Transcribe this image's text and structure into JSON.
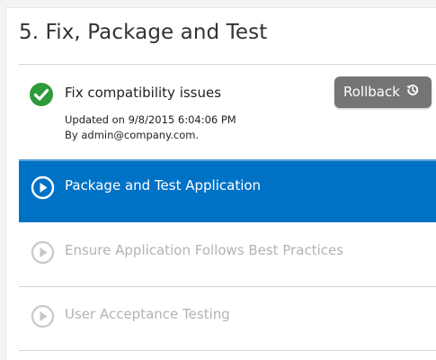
{
  "section": {
    "title": "5. Fix, Package and Test"
  },
  "completed_step": {
    "title": "Fix compatibility issues",
    "updated": "Updated on 9/8/2015 6:04:06 PM",
    "by": "By admin@company.com.",
    "rollback_label": "Rollback",
    "icon": "checkmark-circle-icon",
    "rollback_icon": "history-icon"
  },
  "steps": [
    {
      "label": "Package and Test Application",
      "state": "active",
      "icon": "play-circle-icon"
    },
    {
      "label": "Ensure Application Follows Best Practices",
      "state": "pending",
      "icon": "play-circle-icon"
    },
    {
      "label": "User Acceptance Testing",
      "state": "pending",
      "icon": "play-circle-icon"
    }
  ],
  "colors": {
    "active_background": "#0072c6",
    "check_green": "#2e9a3a",
    "rollback_button": "#757575",
    "pending_text": "#b3b3b3"
  }
}
